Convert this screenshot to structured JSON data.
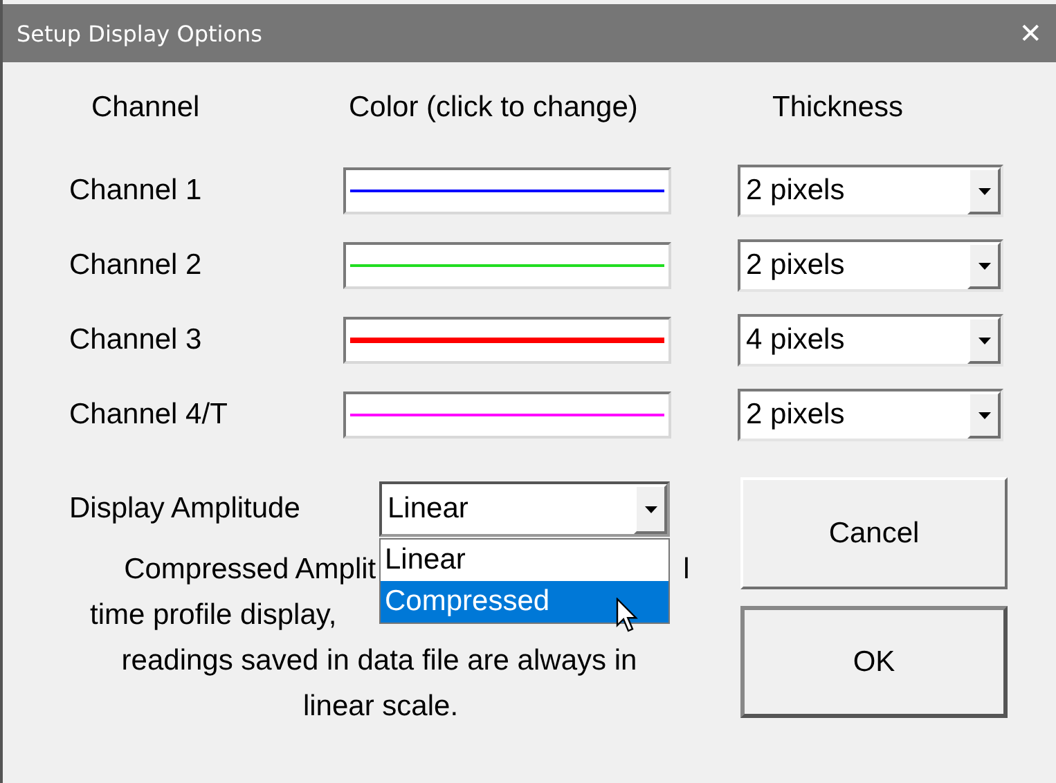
{
  "window": {
    "title": "Setup Display Options",
    "close": "✕"
  },
  "headers": [
    "Channel",
    "Color (click to change)",
    "Thickness"
  ],
  "channels": [
    {
      "name": "Channel 1",
      "color": "#0000ff",
      "thickness": "2 pixels"
    },
    {
      "name": "Channel 2",
      "color": "#22dd22",
      "thickness": "2 pixels"
    },
    {
      "name": "Channel 3",
      "color": "#ff0000",
      "thickness": "4 pixels"
    },
    {
      "name": "Channel 4/T",
      "color": "#ff00ff",
      "thickness": "2 pixels"
    }
  ],
  "amplitude": {
    "label": "Display Amplitude",
    "value": "Linear",
    "expanded": true,
    "options": [
      {
        "label": "Linear",
        "highlighted": false
      },
      {
        "label": "Compressed",
        "highlighted": true
      }
    ]
  },
  "note_lines": [
    [
      "Compressed Amplit",
      "l"
    ],
    [
      "time profile display,"
    ],
    [
      "readings saved in data file are always in"
    ],
    [
      "linear scale."
    ]
  ],
  "buttons": [
    "Cancel",
    "OK"
  ]
}
